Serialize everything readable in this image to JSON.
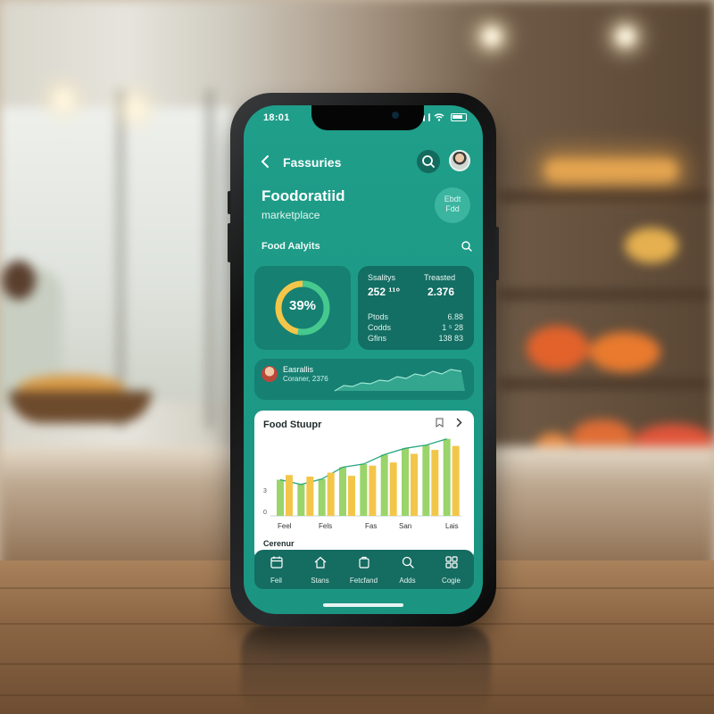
{
  "status": {
    "time": "18:01"
  },
  "nav": {
    "title": "Fassuries",
    "back_icon": "chevron-left-icon",
    "search_icon": "search-icon",
    "avatar_icon": "user-avatar"
  },
  "hero": {
    "title": "Foodoratiid",
    "subtitle": "marketplace",
    "badge_line1": "Ebdt",
    "badge_line2": "Fdd"
  },
  "section": {
    "label": "Food Aalyits"
  },
  "gauge": {
    "label": "39%",
    "value": 0.39,
    "colors": {
      "track": "#0f6157",
      "primary": "#46c98e",
      "secondary": "#f3c64a"
    }
  },
  "stats": {
    "headers": [
      "Ssalitys",
      "Treasted"
    ],
    "values": [
      "252 ¹¹°",
      "2.376"
    ],
    "rows": [
      {
        "label": "Ptods",
        "value": "6.88"
      },
      {
        "label": "Codds",
        "value": "1 ⁵ 28"
      },
      {
        "label": "Gfins",
        "value": "138 83"
      }
    ]
  },
  "wave_card": {
    "line1": "Easrallis",
    "line2": "Coraner, 2376"
  },
  "chart_card": {
    "title": "Food Stuupr",
    "footer": "Cerenur",
    "save_icon": "bookmark-icon",
    "next_icon": "chevron-right-icon"
  },
  "chart_data": {
    "type": "bar",
    "title": "Food Stuupr",
    "xlabel": "",
    "ylabel": "",
    "yticks": [
      "3",
      "0"
    ],
    "xticks": [
      "Feel",
      "Fels",
      "Fas",
      "San",
      "Lais"
    ],
    "ylim": [
      0,
      10
    ],
    "series": [
      {
        "color": "#9ad46a",
        "values": [
          4.6,
          4.0,
          4.7,
          6.2,
          6.6,
          7.8,
          8.6,
          9.0,
          9.8
        ]
      },
      {
        "color": "#f3c64a",
        "values": [
          5.2,
          5.0,
          5.5,
          5.1,
          6.4,
          6.8,
          7.9,
          8.4,
          8.9
        ]
      }
    ],
    "grid": false,
    "legend": "none"
  },
  "tabs": [
    {
      "label": "Feil",
      "icon": "calendar-icon"
    },
    {
      "label": "Stans",
      "icon": "home-icon"
    },
    {
      "label": "Fetcfand",
      "icon": "bag-icon"
    },
    {
      "label": "Adds",
      "icon": "search-icon"
    },
    {
      "label": "Cogie",
      "icon": "grid-icon"
    }
  ],
  "colors": {
    "screen": "#1f9e8a",
    "card_dark": "#136e63",
    "accent_green": "#9ad46a",
    "accent_yellow": "#f3c64a"
  }
}
